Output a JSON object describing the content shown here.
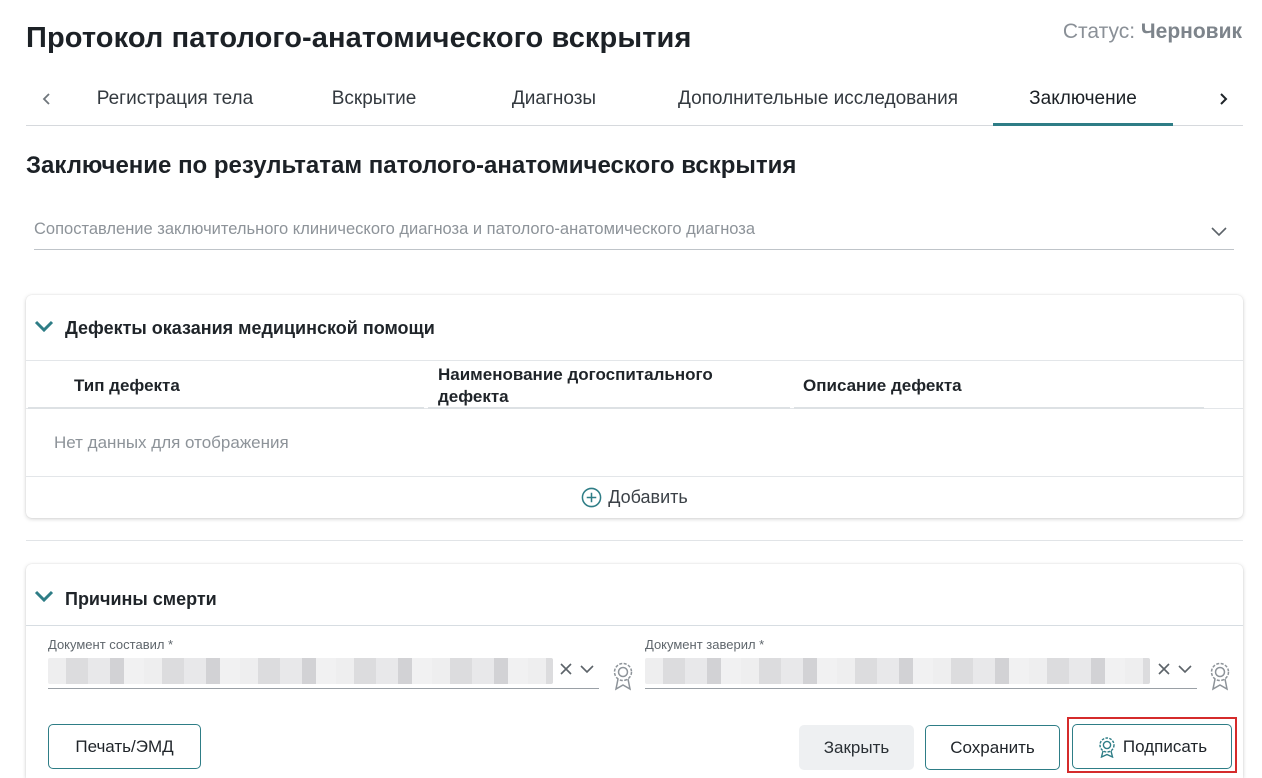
{
  "header": {
    "title": "Протокол патолого-анатомического вскрытия",
    "status_label": "Статус:",
    "status_value": "Черновик"
  },
  "tabs": [
    {
      "label": "Регистрация тела",
      "active": false
    },
    {
      "label": "Вскрытие",
      "active": false
    },
    {
      "label": "Диагнозы",
      "active": false
    },
    {
      "label": "Дополнительные исследования",
      "active": false
    },
    {
      "label": "Заключение",
      "active": true
    }
  ],
  "section": {
    "title": "Заключение по результатам патолого-анатомического вскрытия",
    "comparison_placeholder": "Сопоставление заключительного клинического диагноза и патолого-анатомического диагноза"
  },
  "defects": {
    "title": "Дефекты оказания медицинской помощи",
    "columns": [
      "Тип дефекта",
      "Наименование догоспитального дефекта",
      "Описание дефекта"
    ],
    "empty_text": "Нет данных для отображения",
    "add_label": "Добавить"
  },
  "death_causes": {
    "title": "Причины смерти",
    "composed_label": "Документ составил *",
    "certified_label": "Документ заверил *"
  },
  "actions": {
    "print_label": "Печать/ЭМД",
    "close_label": "Закрыть",
    "save_label": "Сохранить",
    "sign_label": "Подписать"
  },
  "colors": {
    "accent": "#2e7d86",
    "highlight": "#d52b2b"
  },
  "icons": {
    "tab_prev": "chevron-left-icon",
    "tab_next": "chevron-right-icon",
    "dropdown": "chevron-down-icon",
    "collapse": "chevron-down-icon",
    "add": "plus-circle-icon",
    "clear": "close-icon",
    "signature": "seal-icon"
  }
}
